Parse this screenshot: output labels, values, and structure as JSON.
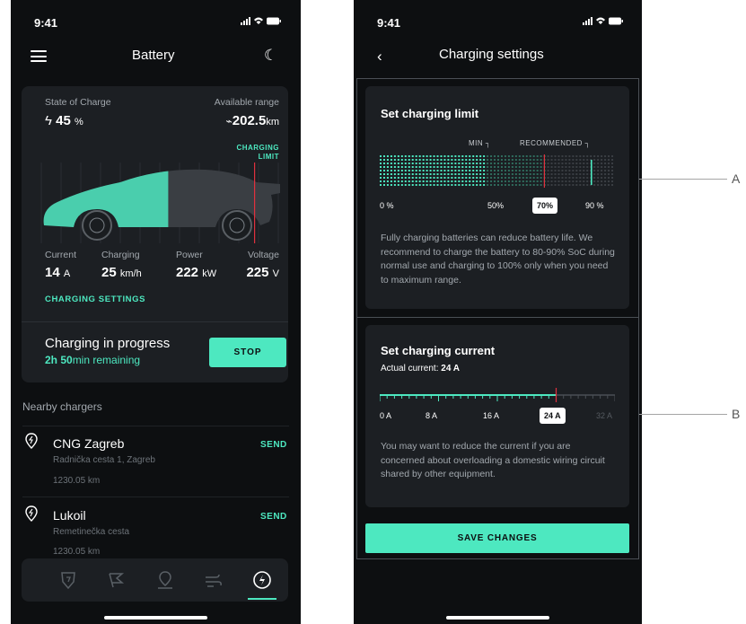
{
  "battery_screen": {
    "status_time": "9:41",
    "title": "Battery",
    "state_of_charge_label": "State of Charge",
    "state_of_charge_value": "45",
    "state_of_charge_unit": "%",
    "available_range_label": "Available range",
    "available_range_value": "202.5",
    "available_range_unit": "km",
    "charging_limit_label_line1": "CHARGING",
    "charging_limit_label_line2": "LIMIT",
    "stats": [
      {
        "label": "Current",
        "value": "14",
        "unit": "A"
      },
      {
        "label": "Charging",
        "value": "25",
        "unit": "km/h"
      },
      {
        "label": "Power",
        "value": "222",
        "unit": "kW"
      },
      {
        "label": "Voltage",
        "value": "225",
        "unit": "V"
      }
    ],
    "charging_settings_link": "CHARGING SETTINGS",
    "progress_title": "Charging in progress",
    "progress_time_h": "2h 50",
    "progress_time_rest": "min remaining",
    "stop_label": "STOP",
    "nearby_title": "Nearby chargers",
    "chargers": [
      {
        "name": "CNG Zagreb",
        "address": "Radnička cesta 1, Zagreb",
        "distance": "1230.05 km",
        "action": "SEND"
      },
      {
        "name": "Lukoil",
        "address": "Remetinečka cesta",
        "distance": "1230.05 km",
        "action": "SEND"
      }
    ],
    "tabs": [
      "shield-icon",
      "flag-icon",
      "map-pin-icon",
      "wind-icon",
      "bolt-icon"
    ],
    "active_tab": 4,
    "charge_fraction": 0.45,
    "charging_limit_fraction": 0.7
  },
  "settings_screen": {
    "status_time": "9:41",
    "title": "Charging settings",
    "limit_card": {
      "title": "Set charging limit",
      "min_label": "MIN",
      "recommended_label": "RECOMMENDED",
      "tick_labels": [
        "0 %",
        "50%",
        "90 %"
      ],
      "selected_label": "70%",
      "current_fraction": 0.45,
      "min_fraction": 0.5,
      "selected_fraction": 0.7,
      "recommended_fraction": 0.9,
      "description": "Fully charging batteries can reduce battery life. We recommend to charge the battery to 80-90% SoC during normal use and charging to 100% only when you need to maximum range."
    },
    "current_card": {
      "title": "Set charging current",
      "actual_label": "Actual current: ",
      "actual_value": "24 A",
      "tick_labels": [
        "0 A",
        "8 A",
        "16 A",
        "32 A"
      ],
      "selected_label": "24 A",
      "selected_fraction": 0.75,
      "description": "You may want to reduce the current if you are concerned about overloading a domestic wiring circuit shared by other equipment."
    },
    "save_label": "SAVE CHANGES"
  },
  "callouts": [
    "A",
    "B"
  ],
  "colors": {
    "accent": "#4de8c0",
    "background": "#0d0f11",
    "card": "#1c1f23",
    "limit_marker": "#e0313e"
  }
}
